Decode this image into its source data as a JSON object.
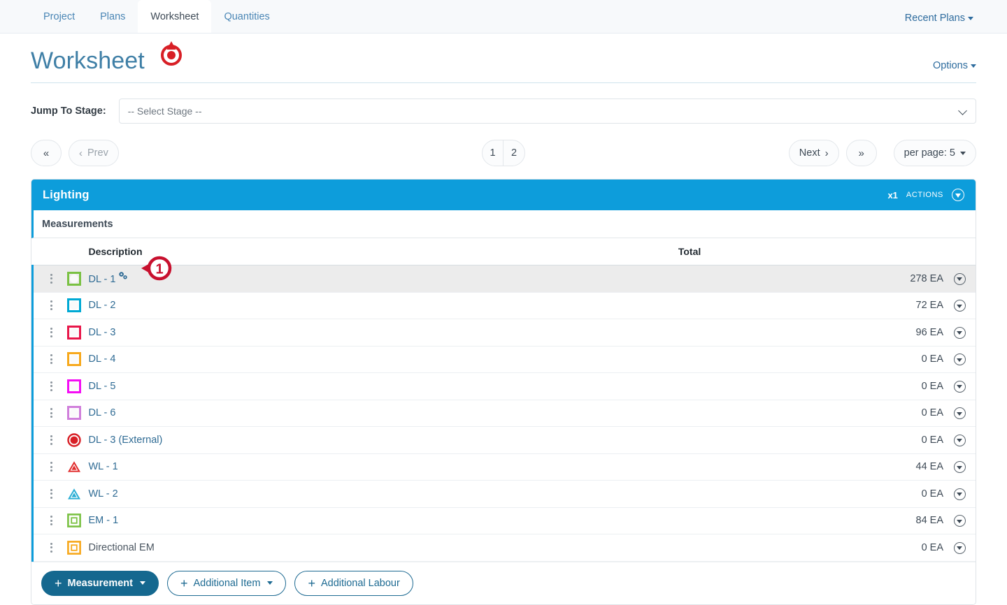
{
  "nav": {
    "tabs": [
      {
        "label": "Project",
        "active": false
      },
      {
        "label": "Plans",
        "active": false
      },
      {
        "label": "Worksheet",
        "active": true
      },
      {
        "label": "Quantities",
        "active": false
      }
    ],
    "recent_plans": "Recent Plans"
  },
  "header": {
    "title": "Worksheet",
    "options": "Options",
    "marker_color": "#d81f26"
  },
  "stage": {
    "label": "Jump To Stage:",
    "selected": "-- Select Stage --"
  },
  "pager": {
    "first_glyph": "«",
    "prev_label": "Prev",
    "prev_glyph": "‹",
    "pages": [
      "1",
      "2"
    ],
    "current_page": "1",
    "next_label": "Next",
    "next_glyph": "›",
    "last_glyph": "»",
    "per_page_label": "per page: 5"
  },
  "card": {
    "title": "Lighting",
    "accent_color": "#0d9ddb",
    "multiplier": "x1",
    "actions_label": "ACTIONS",
    "section_label": "Measurements",
    "columns": {
      "description": "Description",
      "total": "Total"
    },
    "rows": [
      {
        "description": "DL - 1",
        "total": "278 EA",
        "symbol": "square-circle-icon",
        "color": "#7ac143",
        "selected": true,
        "link": true,
        "has_gears": true,
        "callout": "1"
      },
      {
        "description": "DL - 2",
        "total": "72 EA",
        "symbol": "square-circle-icon",
        "color": "#00a9d4",
        "selected": false,
        "link": true,
        "has_gears": false
      },
      {
        "description": "DL - 3",
        "total": "96 EA",
        "symbol": "square-circle-icon",
        "color": "#e8174a",
        "selected": false,
        "link": true,
        "has_gears": false
      },
      {
        "description": "DL - 4",
        "total": "0 EA",
        "symbol": "square-circle-icon",
        "color": "#f7a81b",
        "selected": false,
        "link": true,
        "has_gears": false
      },
      {
        "description": "DL - 5",
        "total": "0 EA",
        "symbol": "square-circle-icon",
        "color": "#f40df4",
        "selected": false,
        "link": true,
        "has_gears": false
      },
      {
        "description": "DL - 6",
        "total": "0 EA",
        "symbol": "square-circle-icon",
        "color": "#d07fdb",
        "selected": false,
        "link": true,
        "has_gears": false
      },
      {
        "description": "DL - 3 (External)",
        "total": "0 EA",
        "symbol": "ring-filled-icon",
        "color": "#d81f26",
        "selected": false,
        "link": true,
        "has_gears": false
      },
      {
        "description": "WL - 1",
        "total": "44 EA",
        "symbol": "triangle-icon",
        "color": "#e02b2b",
        "selected": false,
        "link": true,
        "has_gears": false
      },
      {
        "description": "WL - 2",
        "total": "0 EA",
        "symbol": "triangle-icon",
        "color": "#2aaed4",
        "selected": false,
        "link": true,
        "has_gears": false
      },
      {
        "description": "EM - 1",
        "total": "84 EA",
        "symbol": "nested-square-icon",
        "color": "#7ac143",
        "selected": false,
        "link": true,
        "has_gears": false
      },
      {
        "description": "Directional EM",
        "total": "0 EA",
        "symbol": "nested-square-icon",
        "color": "#f7a81b",
        "selected": false,
        "link": false,
        "has_gears": false
      }
    ],
    "footer_buttons": [
      {
        "label": "Measurement",
        "primary": true,
        "caret": true
      },
      {
        "label": "Additional Item",
        "primary": false,
        "caret": true
      },
      {
        "label": "Additional Labour",
        "primary": false,
        "caret": false
      }
    ]
  }
}
